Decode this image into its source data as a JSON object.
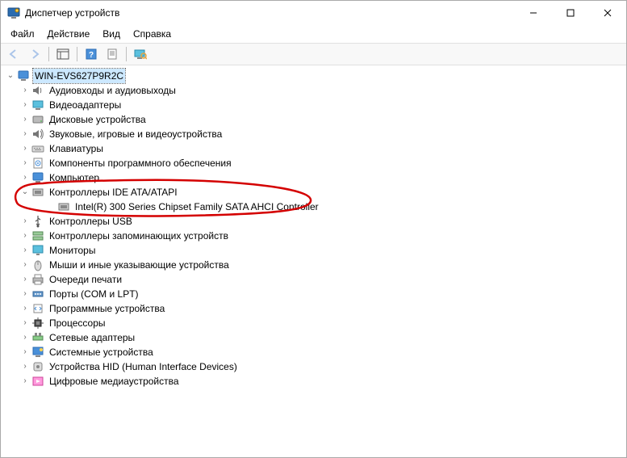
{
  "window": {
    "title": "Диспетчер устройств"
  },
  "menu": {
    "file": "Файл",
    "action": "Действие",
    "view": "Вид",
    "help": "Справка"
  },
  "toolbar": {
    "back": "back",
    "forward": "forward",
    "show_hidden": "show-hidden",
    "help": "help",
    "props": "properties",
    "monitor": "scan-hardware"
  },
  "tree": {
    "root": {
      "label": "WIN-EVS627P9R2C",
      "expanded": true,
      "selected": true
    },
    "categories": [
      {
        "label": "Аудиовходы и аудиовыходы",
        "icon": "speaker",
        "expanded": false
      },
      {
        "label": "Видеоадаптеры",
        "icon": "display-adapter",
        "expanded": false
      },
      {
        "label": "Дисковые устройства",
        "icon": "disk",
        "expanded": false
      },
      {
        "label": "Звуковые, игровые и видеоустройства",
        "icon": "sound",
        "expanded": false
      },
      {
        "label": "Клавиатуры",
        "icon": "keyboard",
        "expanded": false
      },
      {
        "label": "Компоненты программного обеспечения",
        "icon": "software",
        "expanded": false
      },
      {
        "label": "Компьютер",
        "icon": "computer",
        "expanded": false
      },
      {
        "label": "Контроллеры IDE ATA/ATAPI",
        "icon": "ide",
        "expanded": true,
        "children": [
          {
            "label": "Intel(R) 300 Series Chipset Family SATA AHCI Controller",
            "icon": "ide-item"
          }
        ]
      },
      {
        "label": "Контроллеры USB",
        "icon": "usb",
        "expanded": false
      },
      {
        "label": "Контроллеры запоминающих устройств",
        "icon": "storage-ctrl",
        "expanded": false
      },
      {
        "label": "Мониторы",
        "icon": "monitor",
        "expanded": false
      },
      {
        "label": "Мыши и иные указывающие устройства",
        "icon": "mouse",
        "expanded": false
      },
      {
        "label": "Очереди печати",
        "icon": "printer",
        "expanded": false
      },
      {
        "label": "Порты (COM и LPT)",
        "icon": "port",
        "expanded": false
      },
      {
        "label": "Программные устройства",
        "icon": "software-dev",
        "expanded": false
      },
      {
        "label": "Процессоры",
        "icon": "cpu",
        "expanded": false
      },
      {
        "label": "Сетевые адаптеры",
        "icon": "network",
        "expanded": false
      },
      {
        "label": "Системные устройства",
        "icon": "system",
        "expanded": false
      },
      {
        "label": "Устройства HID (Human Interface Devices)",
        "icon": "hid",
        "expanded": false
      },
      {
        "label": "Цифровые медиаустройства",
        "icon": "media",
        "expanded": false
      }
    ]
  },
  "annotation": {
    "color": "#d40000"
  }
}
